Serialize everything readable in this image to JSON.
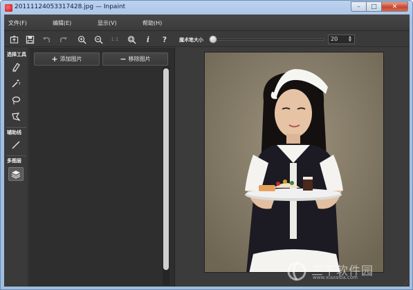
{
  "window": {
    "title": "20111124053317428.jpg — Inpaint",
    "minimize_label": "–",
    "maximize_label": "□",
    "close_label": "✕"
  },
  "menu": [
    {
      "label": "文件(F)"
    },
    {
      "label": "编辑(E)"
    },
    {
      "label": "显示(V)"
    },
    {
      "label": "帮助(H)"
    }
  ],
  "toolbar": {
    "icons": [
      "open-icon",
      "save-icon",
      "undo-icon",
      "redo-icon",
      "zoom-in-icon",
      "zoom-out-icon",
      "actual-size-icon",
      "fit-icon",
      "info-icon",
      "help-icon"
    ],
    "actual_size_label": "1:1",
    "info_label": "i",
    "help_label": "?",
    "magic_wand_label": "魔术笔大小",
    "magic_wand_size": 20,
    "magic_wand_size_text": "20",
    "slider_fraction": 0.03,
    "spin_up": "▲",
    "spin_down": "▼"
  },
  "left_tools": {
    "select_group": "选择工具",
    "guide_group": "辅助线",
    "multi_layer_group": "多图层",
    "tools": [
      "marker-icon",
      "magic-wand-icon",
      "lasso-icon",
      "polygon-lasso-icon",
      "guide-line-icon",
      "layers-icon"
    ]
  },
  "panel": {
    "add_label": "添加图片",
    "remove_label": "移除图片",
    "add_symbol": "+",
    "remove_symbol": "−"
  },
  "watermark": {
    "text": "三下软件园",
    "url": "www.xiazaiba.com"
  },
  "colors": {
    "bg_dark": "#3a3a3a",
    "panel_dark": "#2e2e2e",
    "photo_bg": "#7d7361"
  }
}
